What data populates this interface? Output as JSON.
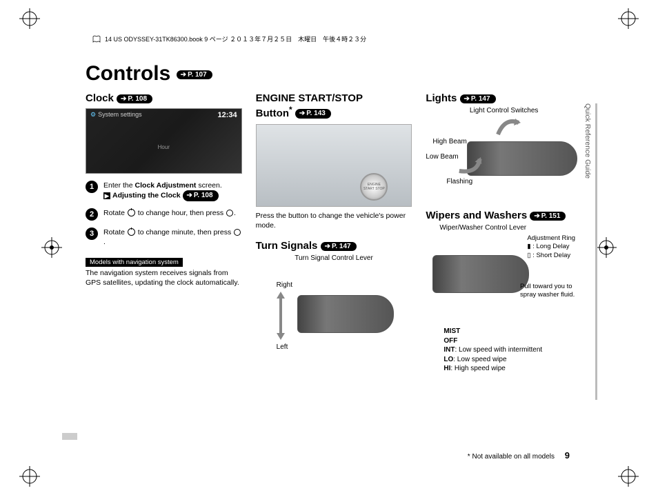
{
  "header_meta": "14 US ODYSSEY-31TK86300.book  9 ページ  ２０１３年７月２５日　木曜日　午後４時２３分",
  "main_title": "Controls",
  "main_title_page": "P. 107",
  "sidebar_text": "Quick Reference Guide",
  "page_number": "9",
  "footnote": "* Not available on all models",
  "clock": {
    "title": "Clock",
    "page": "P. 108",
    "screen_header": "System settings",
    "screen_time": "12:34",
    "screen_label": "Hour",
    "step1_a": "Enter the ",
    "step1_b": "Clock Adjustment",
    "step1_c": " screen.",
    "step1_link_a": "Adjusting the Clock ",
    "step1_link_page": "P. 108",
    "step2": "Rotate  to change hour, then press .",
    "step3": "Rotate  to change minute, then press .",
    "badge": "Models with navigation system",
    "note": "The navigation system receives signals from GPS satellites, updating the clock automatically."
  },
  "engine": {
    "title_a": "ENGINE START/STOP",
    "title_b": "Button",
    "page": "P. 143",
    "btn_text": "ENGINE START STOP",
    "desc": "Press the button to change the vehicle's power mode."
  },
  "turn": {
    "title": "Turn Signals",
    "page": "P. 147",
    "lever_label": "Turn Signal Control Lever",
    "right": "Right",
    "left": "Left"
  },
  "lights": {
    "title": "Lights",
    "page": "P. 147",
    "switches_label": "Light Control Switches",
    "high": "High Beam",
    "low": "Low Beam",
    "flash": "Flashing"
  },
  "wipers": {
    "title": "Wipers and Washers",
    "page": "P. 151",
    "lever_label": "Wiper/Washer Control Lever",
    "adjust_ring": "Adjustment Ring",
    "long_delay": " : Long Delay",
    "short_delay": " : Short Delay",
    "pull": "Pull toward you to spray washer fluid.",
    "mist": "MIST",
    "off": "OFF",
    "int": "INT",
    "int_desc": ": Low speed with intermittent",
    "lo": "LO",
    "lo_desc": ": Low speed wipe",
    "hi": "HI",
    "hi_desc": ": High speed wipe"
  }
}
